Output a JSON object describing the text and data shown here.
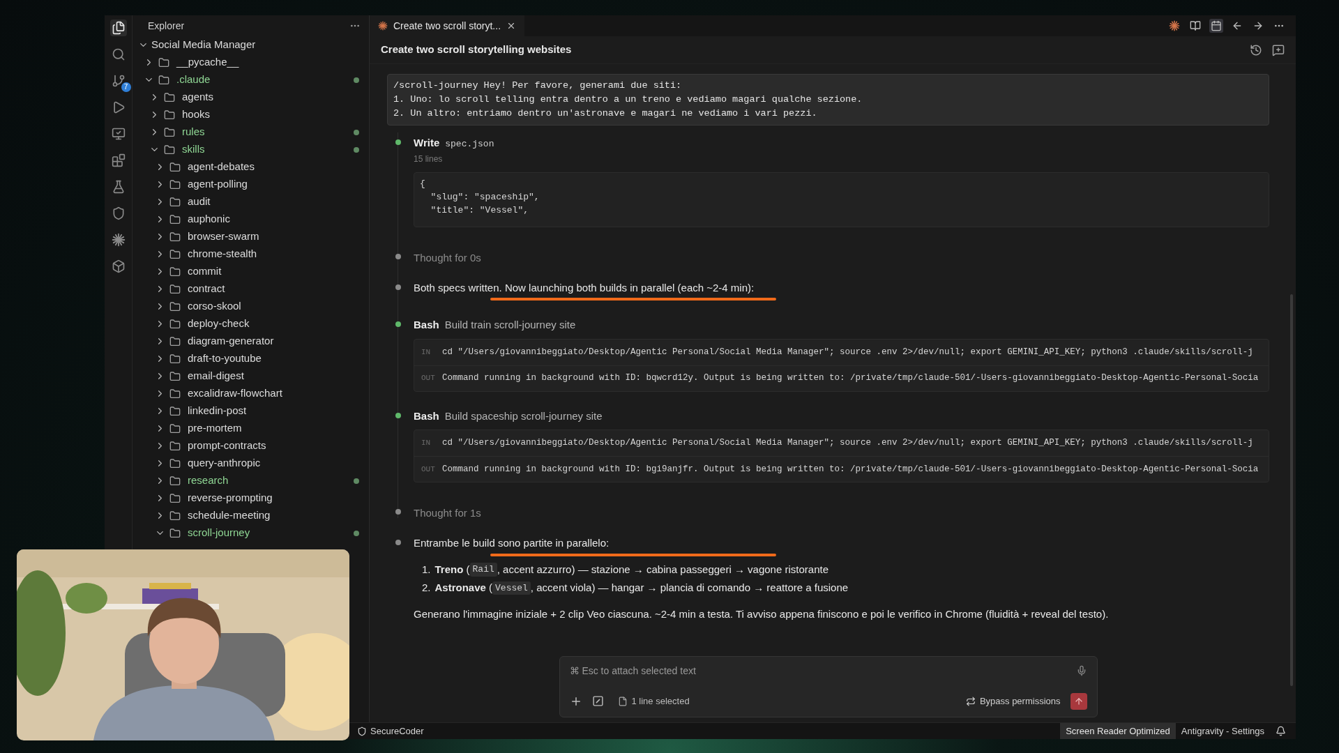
{
  "activity_bar": {
    "items": [
      {
        "kind": "files",
        "selected": true
      },
      {
        "kind": "search",
        "selected": false
      },
      {
        "kind": "branch",
        "selected": false,
        "badge": "7"
      },
      {
        "kind": "run",
        "selected": false
      },
      {
        "kind": "remote",
        "selected": false
      },
      {
        "kind": "extensions",
        "selected": false
      },
      {
        "kind": "flask",
        "selected": false
      },
      {
        "kind": "shield",
        "selected": false
      },
      {
        "kind": "starburst",
        "selected": false
      },
      {
        "kind": "box",
        "selected": false
      }
    ]
  },
  "explorer": {
    "title": "Explorer",
    "tree": {
      "label": "Social Media Manager",
      "expanded": true,
      "children": [
        {
          "label": "__pycache__",
          "expanded": false,
          "modified": false
        },
        {
          "label": ".claude",
          "expanded": true,
          "modified": true,
          "children": [
            {
              "label": "agents",
              "expanded": false,
              "modified": false
            },
            {
              "label": "hooks",
              "expanded": false,
              "modified": false
            },
            {
              "label": "rules",
              "expanded": false,
              "modified": true
            },
            {
              "label": "skills",
              "expanded": true,
              "modified": true,
              "children": [
                {
                  "label": "agent-debates",
                  "expanded": false,
                  "modified": false
                },
                {
                  "label": "agent-polling",
                  "expanded": false,
                  "modified": false
                },
                {
                  "label": "audit",
                  "expanded": false,
                  "modified": false
                },
                {
                  "label": "auphonic",
                  "expanded": false,
                  "modified": false
                },
                {
                  "label": "browser-swarm",
                  "expanded": false,
                  "modified": false
                },
                {
                  "label": "chrome-stealth",
                  "expanded": false,
                  "modified": false
                },
                {
                  "label": "commit",
                  "expanded": false,
                  "modified": false
                },
                {
                  "label": "contract",
                  "expanded": false,
                  "modified": false
                },
                {
                  "label": "corso-skool",
                  "expanded": false,
                  "modified": false
                },
                {
                  "label": "deploy-check",
                  "expanded": false,
                  "modified": false
                },
                {
                  "label": "diagram-generator",
                  "expanded": false,
                  "modified": false
                },
                {
                  "label": "draft-to-youtube",
                  "expanded": false,
                  "modified": false
                },
                {
                  "label": "email-digest",
                  "expanded": false,
                  "modified": false
                },
                {
                  "label": "excalidraw-flowchart",
                  "expanded": false,
                  "modified": false
                },
                {
                  "label": "linkedin-post",
                  "expanded": false,
                  "modified": false
                },
                {
                  "label": "pre-mortem",
                  "expanded": false,
                  "modified": false
                },
                {
                  "label": "prompt-contracts",
                  "expanded": false,
                  "modified": false
                },
                {
                  "label": "query-anthropic",
                  "expanded": false,
                  "modified": false
                },
                {
                  "label": "research",
                  "expanded": false,
                  "modified": true
                },
                {
                  "label": "reverse-prompting",
                  "expanded": false,
                  "modified": false
                },
                {
                  "label": "schedule-meeting",
                  "expanded": false,
                  "modified": false
                },
                {
                  "label": "scroll-journey",
                  "expanded": true,
                  "modified": true
                }
              ]
            }
          ]
        }
      ]
    }
  },
  "editor": {
    "tab": {
      "title": "Create two scroll storyt...",
      "selected": true
    },
    "toolbar": [
      {
        "kind": "starburst",
        "selected": false
      },
      {
        "kind": "book",
        "selected": false
      },
      {
        "kind": "calendar",
        "selected": true
      },
      {
        "kind": "back",
        "selected": false
      },
      {
        "kind": "forward",
        "selected": false
      },
      {
        "kind": "more",
        "selected": false
      }
    ]
  },
  "chat": {
    "title": "Create two scroll storytelling websites",
    "prompt": [
      "/scroll-journey Hey! Per favore, generami due siti:",
      "1. Uno: lo scroll telling entra dentro a un treno e vediamo magari qualche sezione.",
      "2. Un altro: entriamo dentro un'astronave e magari ne vediamo i vari pezzi."
    ],
    "items": [
      {
        "kind": "tool",
        "color": "#5fb86a",
        "tool": "Write",
        "detail": "spec.json",
        "meta": "15 lines",
        "code": [
          "{",
          "  \"slug\": \"spaceship\",",
          "  \"title\": \"Vessel\","
        ]
      },
      {
        "kind": "thought",
        "color": "#8a8a8a",
        "text": "Thought for 0s"
      },
      {
        "kind": "message",
        "color": "#8a8a8a",
        "text": "Both specs written. Now launching both builds in parallel (each ~2-4 min):",
        "underlined": true
      },
      {
        "kind": "bash",
        "color": "#5fb86a",
        "tool": "Bash",
        "detail": "Build train scroll-journey site",
        "io": [
          {
            "label": "IN",
            "text": "cd \"/Users/giovannibeggiato/Desktop/Agentic Personal/Social Media Manager\"; source .env 2>/dev/null; export GEMINI_API_KEY; python3 .claude/skills/scroll-j"
          },
          {
            "label": "OUT",
            "text": "Command running in background with ID: bqwcrd12y. Output is being written to: /private/tmp/claude-501/-Users-giovannibeggiato-Desktop-Agentic-Personal-Socia"
          }
        ]
      },
      {
        "kind": "bash",
        "color": "#5fb86a",
        "tool": "Bash",
        "detail": "Build spaceship scroll-journey site",
        "io": [
          {
            "label": "IN",
            "text": "cd \"/Users/giovannibeggiato/Desktop/Agentic Personal/Social Media Manager\"; source .env 2>/dev/null; export GEMINI_API_KEY; python3 .claude/skills/scroll-j"
          },
          {
            "label": "OUT",
            "text": "Command running in background with ID: bgi9anjfr. Output is being written to: /private/tmp/claude-501/-Users-giovannibeggiato-Desktop-Agentic-Personal-Socia"
          }
        ]
      },
      {
        "kind": "thought",
        "color": "#8a8a8a",
        "text": "Thought for 1s"
      },
      {
        "kind": "message",
        "color": "#8a8a8a",
        "text": "Entrambe le build sono partite in parallelo:",
        "underlined": true
      },
      {
        "kind": "list",
        "entries": [
          {
            "number": "1.",
            "lead": "**Treno** (",
            "code": "Rail",
            "rest": ", accent azzurro) — stazione → cabina passeggeri → vagone ristorante"
          },
          {
            "number": "2.",
            "lead": "**Astronave** (",
            "code": "Vessel",
            "rest": ", accent viola) — hangar → plancia di comando → reattore a fusione"
          }
        ]
      },
      {
        "kind": "paragraph",
        "text": "Generano l'immagine iniziale + 2 clip Veo ciascuna. ~2-4 min a testa. Ti avviso appena finiscono e poi le verifico in Chrome (fluidità + reveal del testo)."
      }
    ],
    "composer": {
      "placeholder": "⌘ Esc to attach selected text",
      "file_label": "1 line selected",
      "permissions_label": "Bypass permissions"
    }
  },
  "status_bar": {
    "left": "SecureCoder",
    "items": [
      {
        "label": "Screen Reader Optimized",
        "highlighted": true
      },
      {
        "label": "Antigravity - Settings",
        "highlighted": false
      }
    ]
  }
}
